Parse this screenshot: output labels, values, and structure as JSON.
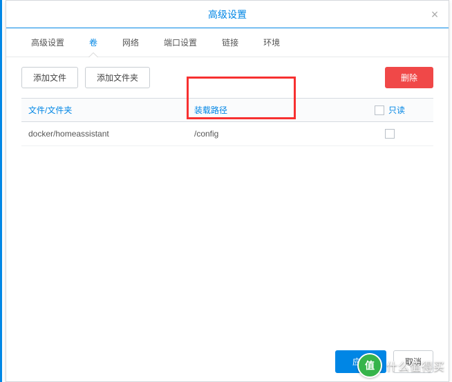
{
  "modal": {
    "title": "高级设置",
    "close": "×"
  },
  "tabs": {
    "items": [
      {
        "label": "高级设置"
      },
      {
        "label": "卷"
      },
      {
        "label": "网络"
      },
      {
        "label": "端口设置"
      },
      {
        "label": "链接"
      },
      {
        "label": "环境"
      }
    ],
    "activeIndex": 1
  },
  "toolbar": {
    "addFile": "添加文件",
    "addFolder": "添加文件夹",
    "delete": "删除"
  },
  "table": {
    "headers": {
      "file": "文件/文件夹",
      "path": "装载路径",
      "readonly": "只读"
    },
    "rows": [
      {
        "file": "docker/homeassistant",
        "path": "/config",
        "readonly": false
      }
    ]
  },
  "footer": {
    "apply": "应用",
    "cancel": "取消"
  },
  "watermark": {
    "badge": "值",
    "text": "什么值得买"
  }
}
